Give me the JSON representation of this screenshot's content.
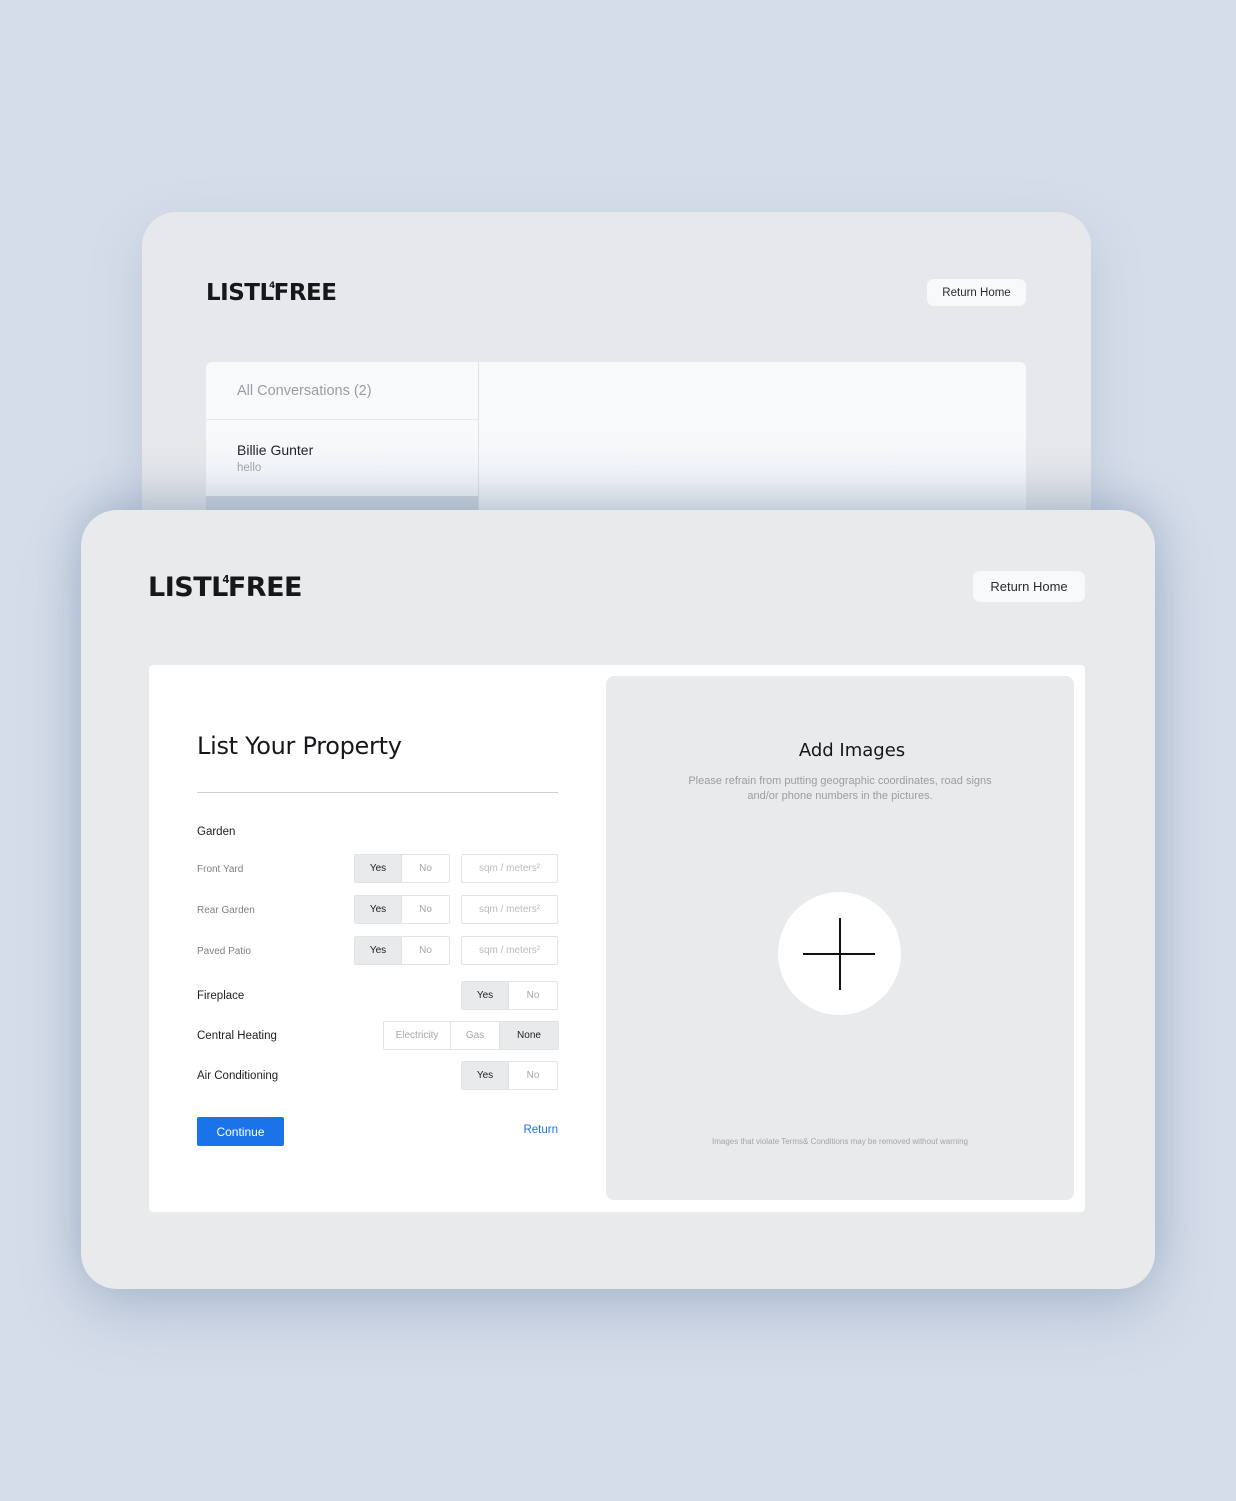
{
  "brand": {
    "logo_left": "LIST",
    "logo_mark": "L",
    "logo_mark_small": "4",
    "logo_right": "FREE"
  },
  "messages_screen": {
    "return_home_label": "Return Home",
    "list_header": "All Conversations (2)",
    "conversations": [
      {
        "name": "Billie Gunter",
        "preview": "hello"
      }
    ]
  },
  "form_screen": {
    "return_home_label": "Return Home",
    "title": "List Your Property",
    "garden": {
      "label": "Garden",
      "rows": [
        {
          "label": "Front Yard",
          "yes": "Yes",
          "no": "No",
          "selected": "Yes",
          "area_placeholder": "sqm / meters²"
        },
        {
          "label": "Rear Garden",
          "yes": "Yes",
          "no": "No",
          "selected": "Yes",
          "area_placeholder": "sqm / meters²"
        },
        {
          "label": "Paved Patio",
          "yes": "Yes",
          "no": "No",
          "selected": "Yes",
          "area_placeholder": "sqm / meters²"
        }
      ]
    },
    "fireplace": {
      "label": "Fireplace",
      "options": [
        "Yes",
        "No"
      ],
      "selected": "Yes"
    },
    "central_heating": {
      "label": "Central Heating",
      "options": [
        "Electricity",
        "Gas",
        "None"
      ],
      "selected": "None"
    },
    "air_conditioning": {
      "label": "Air Conditioning",
      "options": [
        "Yes",
        "No"
      ],
      "selected": "Yes"
    },
    "continue_label": "Continue",
    "return_label": "Return",
    "images": {
      "title": "Add Images",
      "note": "Please refrain from putting geographic coordinates, road signs and/or phone numbers in the pictures.",
      "footer": "Images that violate Terms& Conditions may be removed without warning",
      "add_icon": "plus-icon"
    }
  },
  "colors": {
    "accent": "#1a73e8",
    "background": "#d5dde9",
    "card": "#e9eaec",
    "selected_option": "#e9eaec"
  }
}
